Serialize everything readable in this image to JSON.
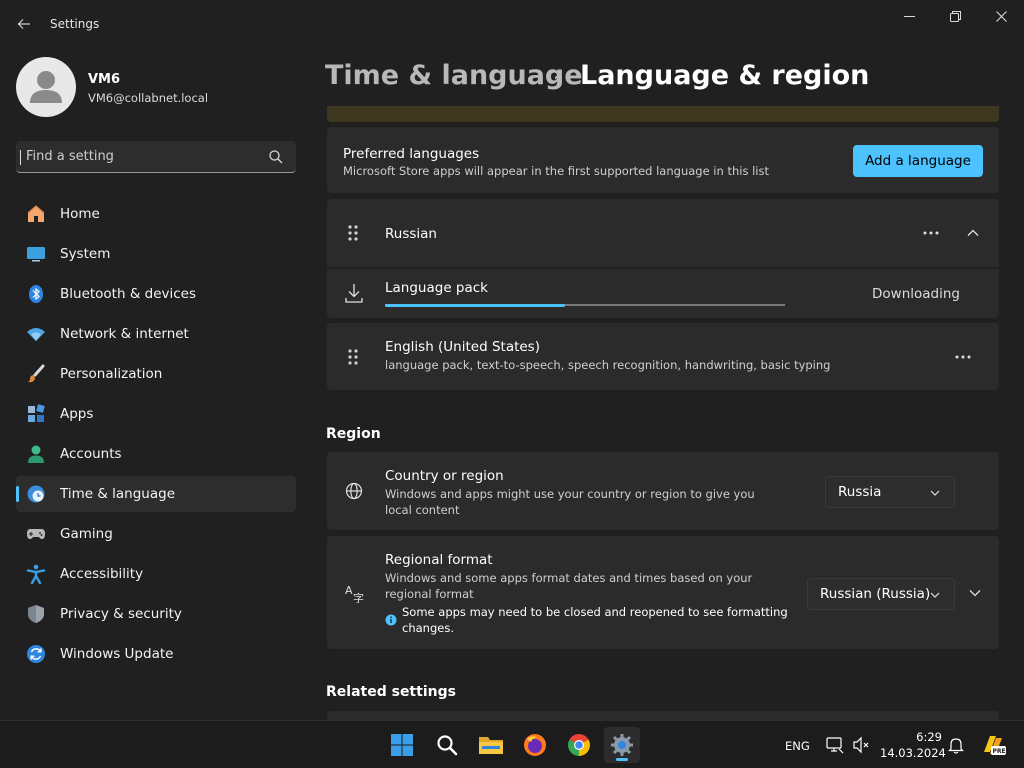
{
  "window": {
    "app_title": "Settings"
  },
  "profile": {
    "name": "VM6",
    "email": "VM6@collabnet.local"
  },
  "search": {
    "placeholder": "Find a setting"
  },
  "sidebar": {
    "items": [
      {
        "label": "Home",
        "icon": "home-icon",
        "active": false
      },
      {
        "label": "System",
        "icon": "monitor-icon",
        "active": false
      },
      {
        "label": "Bluetooth & devices",
        "icon": "bluetooth-icon",
        "active": false
      },
      {
        "label": "Network & internet",
        "icon": "wifi-icon",
        "active": false
      },
      {
        "label": "Personalization",
        "icon": "brush-icon",
        "active": false
      },
      {
        "label": "Apps",
        "icon": "apps-icon",
        "active": false
      },
      {
        "label": "Accounts",
        "icon": "person-icon",
        "active": false
      },
      {
        "label": "Time & language",
        "icon": "globe-clock-icon",
        "active": true
      },
      {
        "label": "Gaming",
        "icon": "gamepad-icon",
        "active": false
      },
      {
        "label": "Accessibility",
        "icon": "accessibility-icon",
        "active": false
      },
      {
        "label": "Privacy & security",
        "icon": "shield-icon",
        "active": false
      },
      {
        "label": "Windows Update",
        "icon": "update-icon",
        "active": false
      }
    ]
  },
  "header": {
    "parent": "Time & language",
    "separator": "›",
    "current": "Language & region"
  },
  "preferred_languages": {
    "title": "Preferred languages",
    "subtitle": "Microsoft Store apps will appear in the first supported language in this list",
    "add_button": "Add a language"
  },
  "languages": [
    {
      "name": "Russian",
      "expanded": true,
      "pack": {
        "label": "Language pack",
        "status": "Downloading",
        "progress": 0.45
      }
    },
    {
      "name": "English (United States)",
      "features": "language pack, text-to-speech, speech recognition, handwriting, basic typing"
    }
  ],
  "region": {
    "section_title": "Region",
    "country": {
      "title": "Country or region",
      "subtitle": "Windows and apps might use your country or region to give you local content",
      "value": "Russia"
    },
    "format": {
      "title": "Regional format",
      "subtitle": "Windows and some apps format dates and times based on your regional format",
      "note": "Some apps may need to be closed and reopened to see formatting changes.",
      "value": "Russian (Russia)"
    }
  },
  "related": {
    "section_title": "Related settings"
  },
  "taskbar": {
    "apps": [
      "start-icon",
      "search-icon",
      "file-explorer-icon",
      "firefox-icon",
      "chrome-icon",
      "settings-icon"
    ],
    "language": "ENG",
    "time": "6:29",
    "date": "14.03.2024"
  },
  "colors": {
    "accent": "#4cc2ff",
    "background": "#202020",
    "card": "#2b2b2b"
  }
}
